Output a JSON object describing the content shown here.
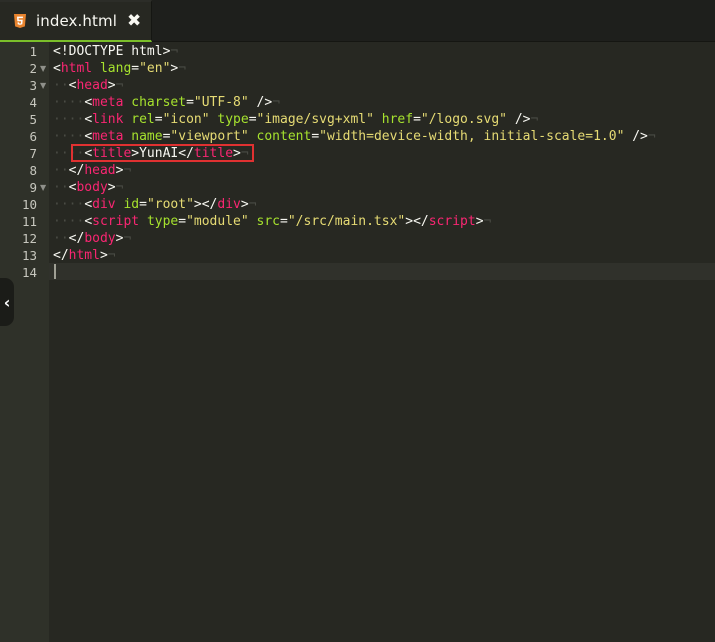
{
  "tab": {
    "icon": "html5-icon",
    "title": "index.html",
    "close_glyph": "✖"
  },
  "editor": {
    "active_line": 14,
    "highlighted_line": 7,
    "lines": [
      {
        "n": "1",
        "fold": false,
        "tokens": [
          [
            "pl",
            "<!DOCTYPE html>"
          ],
          [
            "eol",
            "¬"
          ]
        ]
      },
      {
        "n": "2",
        "fold": true,
        "tokens": [
          [
            "pl",
            "<"
          ],
          [
            "tg",
            "html"
          ],
          [
            "pl",
            " "
          ],
          [
            "at",
            "lang"
          ],
          [
            "pl",
            "="
          ],
          [
            "st",
            "\"en\""
          ],
          [
            "pl",
            ">"
          ],
          [
            "eol",
            "¬"
          ]
        ]
      },
      {
        "n": "3",
        "fold": true,
        "tokens": [
          [
            "ws",
            "··"
          ],
          [
            "pl",
            "<"
          ],
          [
            "tg",
            "head"
          ],
          [
            "pl",
            ">"
          ],
          [
            "eol",
            "¬"
          ]
        ]
      },
      {
        "n": "4",
        "fold": false,
        "tokens": [
          [
            "ws",
            "····"
          ],
          [
            "pl",
            "<"
          ],
          [
            "tg",
            "meta"
          ],
          [
            "pl",
            " "
          ],
          [
            "at",
            "charset"
          ],
          [
            "pl",
            "="
          ],
          [
            "st",
            "\"UTF-8\""
          ],
          [
            "pl",
            " />"
          ],
          [
            "eol",
            "¬"
          ]
        ]
      },
      {
        "n": "5",
        "fold": false,
        "tokens": [
          [
            "ws",
            "····"
          ],
          [
            "pl",
            "<"
          ],
          [
            "tg",
            "link"
          ],
          [
            "pl",
            " "
          ],
          [
            "at",
            "rel"
          ],
          [
            "pl",
            "="
          ],
          [
            "st",
            "\"icon\""
          ],
          [
            "pl",
            " "
          ],
          [
            "at",
            "type"
          ],
          [
            "pl",
            "="
          ],
          [
            "st",
            "\"image/svg+xml\""
          ],
          [
            "pl",
            " "
          ],
          [
            "at",
            "href"
          ],
          [
            "pl",
            "="
          ],
          [
            "st",
            "\"/logo.svg\""
          ],
          [
            "pl",
            " />"
          ],
          [
            "eol",
            "¬"
          ]
        ]
      },
      {
        "n": "6",
        "fold": false,
        "tokens": [
          [
            "ws",
            "····"
          ],
          [
            "pl",
            "<"
          ],
          [
            "tg",
            "meta"
          ],
          [
            "pl",
            " "
          ],
          [
            "at",
            "name"
          ],
          [
            "pl",
            "="
          ],
          [
            "st",
            "\"viewport\""
          ],
          [
            "pl",
            " "
          ],
          [
            "at",
            "content"
          ],
          [
            "pl",
            "="
          ],
          [
            "st",
            "\"width=device-width, initial-scale=1.0\""
          ],
          [
            "pl",
            " />"
          ],
          [
            "eol",
            "¬"
          ]
        ]
      },
      {
        "n": "7",
        "fold": false,
        "tokens": [
          [
            "ws",
            "····"
          ],
          [
            "pl",
            "<"
          ],
          [
            "tg",
            "title"
          ],
          [
            "pl",
            ">YunAI</"
          ],
          [
            "tg",
            "title"
          ],
          [
            "pl",
            ">"
          ],
          [
            "eol",
            "¬"
          ]
        ]
      },
      {
        "n": "8",
        "fold": false,
        "tokens": [
          [
            "ws",
            "··"
          ],
          [
            "pl",
            "</"
          ],
          [
            "tg",
            "head"
          ],
          [
            "pl",
            ">"
          ],
          [
            "eol",
            "¬"
          ]
        ]
      },
      {
        "n": "9",
        "fold": true,
        "tokens": [
          [
            "ws",
            "··"
          ],
          [
            "pl",
            "<"
          ],
          [
            "tg",
            "body"
          ],
          [
            "pl",
            ">"
          ],
          [
            "eol",
            "¬"
          ]
        ]
      },
      {
        "n": "10",
        "fold": false,
        "tokens": [
          [
            "ws",
            "····"
          ],
          [
            "pl",
            "<"
          ],
          [
            "tg",
            "div"
          ],
          [
            "pl",
            " "
          ],
          [
            "at",
            "id"
          ],
          [
            "pl",
            "="
          ],
          [
            "st",
            "\"root\""
          ],
          [
            "pl",
            "></"
          ],
          [
            "tg",
            "div"
          ],
          [
            "pl",
            ">"
          ],
          [
            "eol",
            "¬"
          ]
        ]
      },
      {
        "n": "11",
        "fold": false,
        "tokens": [
          [
            "ws",
            "····"
          ],
          [
            "pl",
            "<"
          ],
          [
            "tg",
            "script"
          ],
          [
            "pl",
            " "
          ],
          [
            "at",
            "type"
          ],
          [
            "pl",
            "="
          ],
          [
            "st",
            "\"module\""
          ],
          [
            "pl",
            " "
          ],
          [
            "at",
            "src"
          ],
          [
            "pl",
            "="
          ],
          [
            "st",
            "\"/src/main.tsx\""
          ],
          [
            "pl",
            "></"
          ],
          [
            "tg",
            "script"
          ],
          [
            "pl",
            ">"
          ],
          [
            "eol",
            "¬"
          ]
        ]
      },
      {
        "n": "12",
        "fold": false,
        "tokens": [
          [
            "ws",
            "··"
          ],
          [
            "pl",
            "</"
          ],
          [
            "tg",
            "body"
          ],
          [
            "pl",
            ">"
          ],
          [
            "eol",
            "¬"
          ]
        ]
      },
      {
        "n": "13",
        "fold": false,
        "tokens": [
          [
            "pl",
            "</"
          ],
          [
            "tg",
            "html"
          ],
          [
            "pl",
            ">"
          ],
          [
            "eol",
            "¬"
          ]
        ]
      },
      {
        "n": "14",
        "fold": false,
        "tokens": []
      }
    ]
  },
  "colors": {
    "background": "#272822",
    "gutter": "#2f3129",
    "tag": "#f92672",
    "attribute": "#a6e22e",
    "string": "#e6db74",
    "highlight_box": "#e03131",
    "tab_accent": "#7bbf2a"
  },
  "side_toggle": {
    "icon": "chevron-left-icon",
    "glyph": "‹"
  }
}
